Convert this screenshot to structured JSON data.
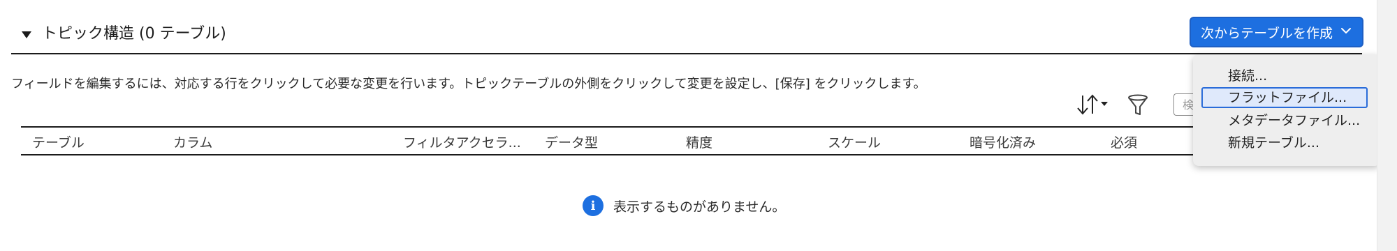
{
  "section": {
    "title": "トピック構造 (0 テーブル)",
    "create_button_label": "次からテーブルを作成"
  },
  "instruction": "フィールドを編集するには、対応する行をクリックして必要な変更を行います。トピックテーブルの外側をクリックして変更を設定し、[保存] をクリックします。",
  "toolbar": {
    "sort_icon": "sort-arrows-icon",
    "filter_icon": "filter-funnel-icon",
    "search_placeholder_partial": "検"
  },
  "table": {
    "columns": [
      "テーブル",
      "カラム",
      "フィルタアクセラ...",
      "データ型",
      "精度",
      "スケール",
      "暗号化済み",
      "必須"
    ]
  },
  "empty_state": {
    "icon": "info-icon",
    "message": "表示するものがありません。"
  },
  "dropdown": {
    "items": [
      {
        "label": "接続..."
      },
      {
        "label": "フラットファイル..."
      },
      {
        "label": "メタデータファイル..."
      },
      {
        "label": "新規テーブル..."
      }
    ],
    "highlighted_index": 1
  },
  "colors": {
    "accent": "#1d6fe0",
    "menu_highlight_border": "#2a6cd9",
    "menu_background": "#eeeeee"
  }
}
